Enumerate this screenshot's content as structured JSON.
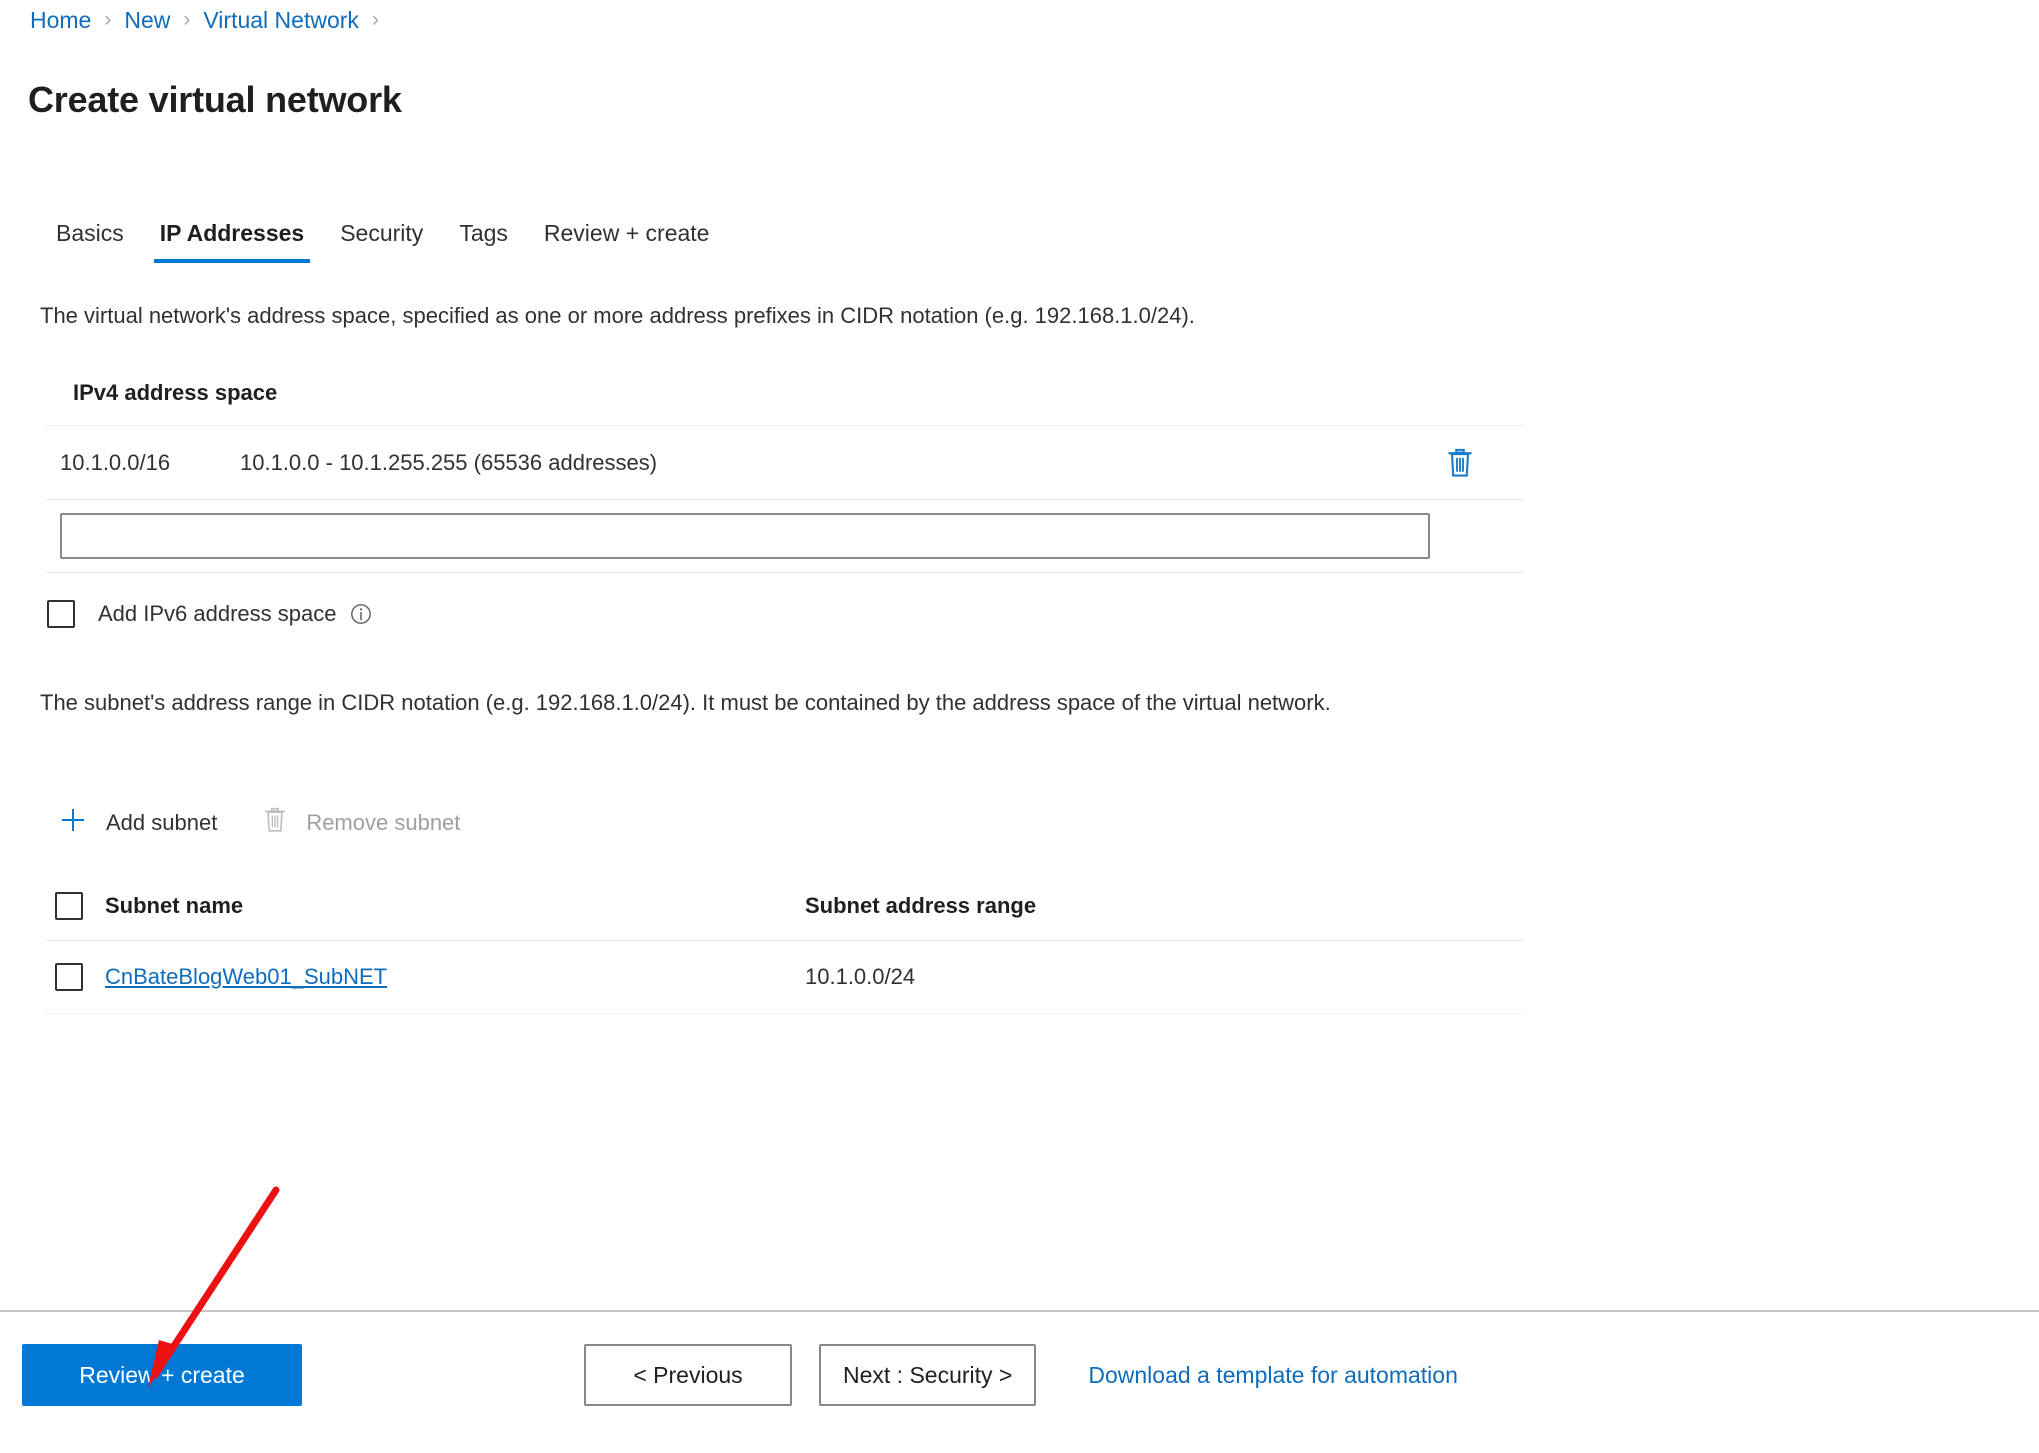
{
  "breadcrumb": {
    "items": [
      "Home",
      "New",
      "Virtual Network"
    ],
    "separator": "›"
  },
  "page": {
    "title": "Create virtual network"
  },
  "tabs": [
    {
      "label": "Basics",
      "active": false
    },
    {
      "label": "IP Addresses",
      "active": true
    },
    {
      "label": "Security",
      "active": false
    },
    {
      "label": "Tags",
      "active": false
    },
    {
      "label": "Review + create",
      "active": false
    }
  ],
  "ip_addresses": {
    "intro": "The virtual network's address space, specified as one or more address prefixes in CIDR notation (e.g. 192.168.1.0/24).",
    "ipv4_section_label": "IPv4 address space",
    "address_rows": [
      {
        "prefix": "10.1.0.0/16",
        "range": "10.1.0.0 - 10.1.255.255 (65536 addresses)",
        "delete_icon": "trash-icon"
      }
    ],
    "new_address_input_value": "",
    "new_address_input_placeholder": "",
    "ipv6": {
      "checkbox_label": "Add IPv6 address space",
      "checked": false,
      "info_icon": "info-icon"
    }
  },
  "subnets": {
    "intro": "The subnet's address range in CIDR notation (e.g. 192.168.1.0/24). It must be contained by the address space of the virtual network.",
    "commands": [
      {
        "label": "Add subnet",
        "icon": "plus-icon",
        "disabled": false
      },
      {
        "label": "Remove subnet",
        "icon": "trash-icon",
        "disabled": true
      }
    ],
    "columns": [
      "Subnet name",
      "Subnet address range"
    ],
    "rows": [
      {
        "name": "CnBateBlogWeb01_SubNET",
        "range": "10.1.0.0/24",
        "selected": false
      }
    ]
  },
  "footer": {
    "review_create_label": "Review + create",
    "previous_label": "< Previous",
    "next_label": "Next : Security >",
    "download_template_label": "Download a template for automation"
  },
  "colors": {
    "accent": "#0078d4",
    "link": "#0f6cbd",
    "text": "#323130",
    "annotation_arrow": "#ee1111",
    "border": "#edebe9"
  }
}
